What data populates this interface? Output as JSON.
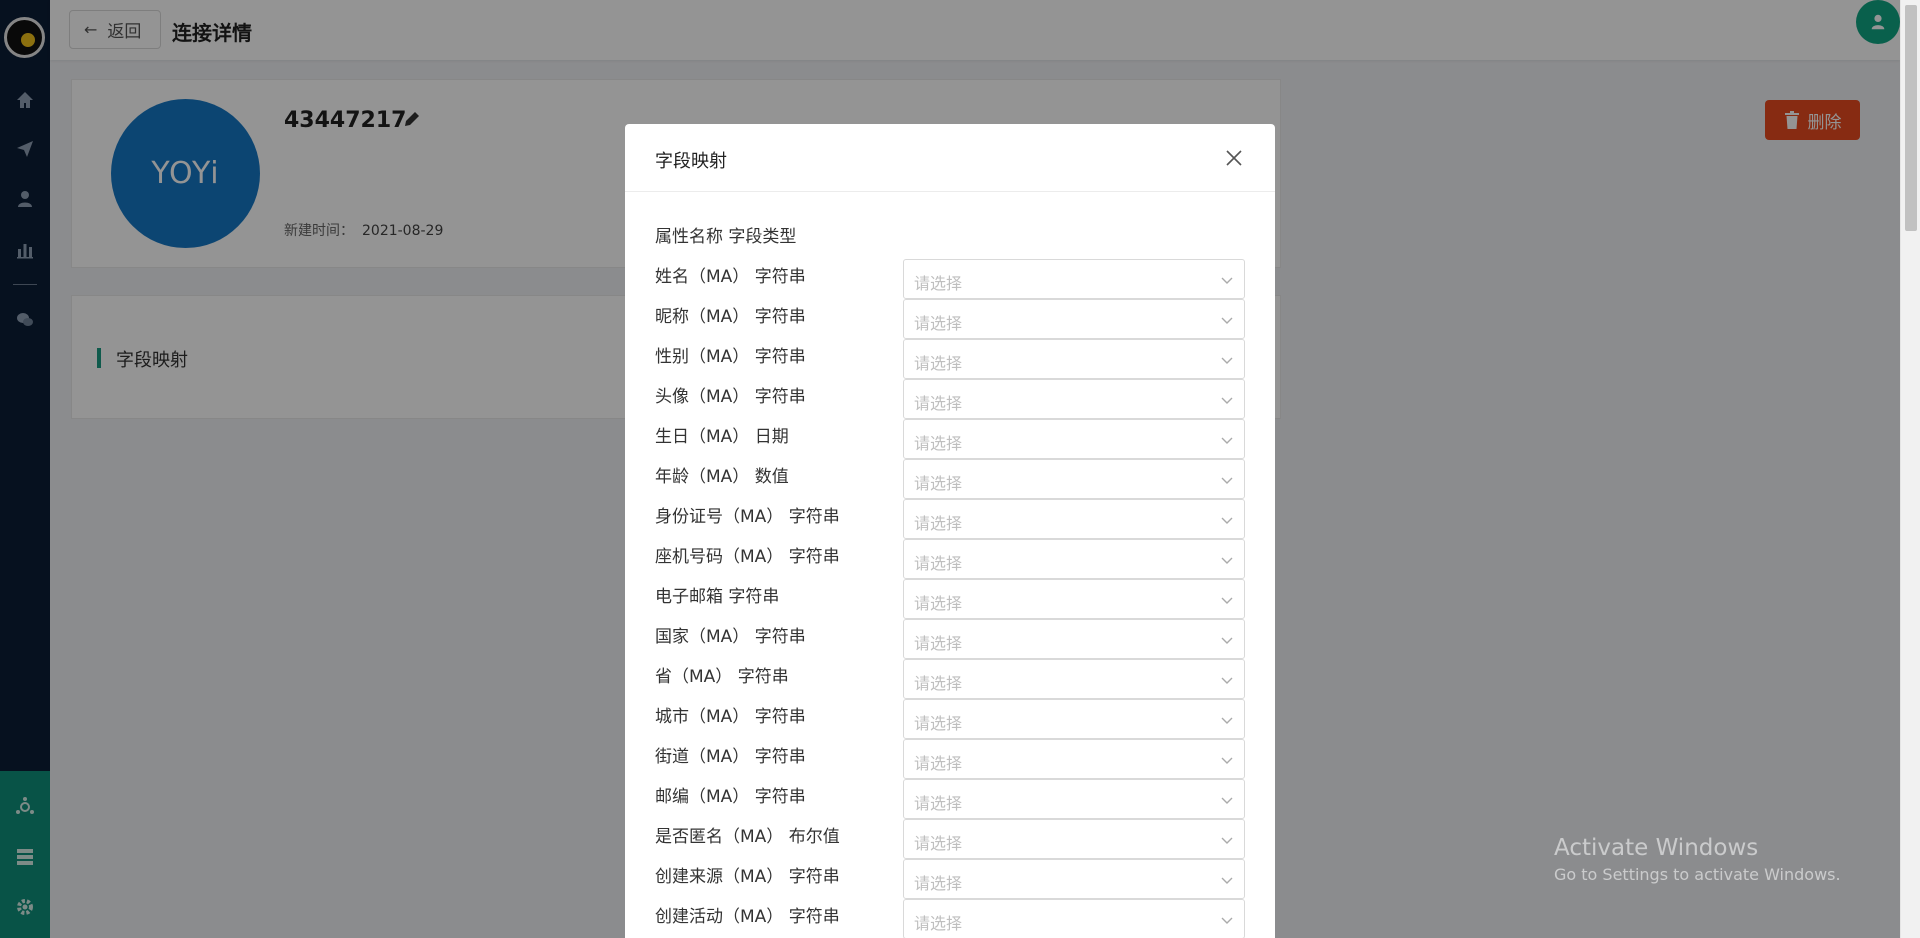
{
  "header": {
    "back_label": "返回",
    "title": "连接详情"
  },
  "connection": {
    "avatar_text": "YOYi",
    "name": "43447217",
    "created_label": "新建时间：",
    "created_value": "2021-08-29",
    "delete_label": "删除"
  },
  "section": {
    "label": "字段映射"
  },
  "modal": {
    "title": "字段映射",
    "column_header": "属性名称 字段类型",
    "placeholder": "请选择",
    "fields": [
      {
        "label": "姓名（MA） 字符串"
      },
      {
        "label": "昵称（MA） 字符串"
      },
      {
        "label": "性别（MA） 字符串"
      },
      {
        "label": "头像（MA） 字符串"
      },
      {
        "label": "生日（MA） 日期"
      },
      {
        "label": "年龄（MA） 数值"
      },
      {
        "label": "身份证号（MA） 字符串"
      },
      {
        "label": "座机号码（MA） 字符串"
      },
      {
        "label": "电子邮箱 字符串"
      },
      {
        "label": "国家（MA） 字符串"
      },
      {
        "label": "省（MA） 字符串"
      },
      {
        "label": "城市（MA） 字符串"
      },
      {
        "label": "街道（MA） 字符串"
      },
      {
        "label": "邮编（MA） 字符串"
      },
      {
        "label": "是否匿名（MA） 布尔值"
      },
      {
        "label": "创建来源（MA） 字符串"
      },
      {
        "label": "创建活动（MA） 字符串"
      }
    ]
  },
  "watermark": {
    "line1": "Activate Windows",
    "line2": "Go to Settings to activate Windows."
  },
  "colors": {
    "sidebar": "#0c1e36",
    "sidebar_bottom": "#0e8f7b",
    "accent": "#1a9c84",
    "danger": "#e84a1f",
    "avatar": "#1677c4"
  },
  "icons": {
    "sidebar_top": [
      "home-icon",
      "send-icon",
      "user-icon",
      "bar-chart-icon",
      "wechat-icon"
    ],
    "sidebar_bottom": [
      "network-icon",
      "server-icon",
      "settings-icon"
    ]
  }
}
